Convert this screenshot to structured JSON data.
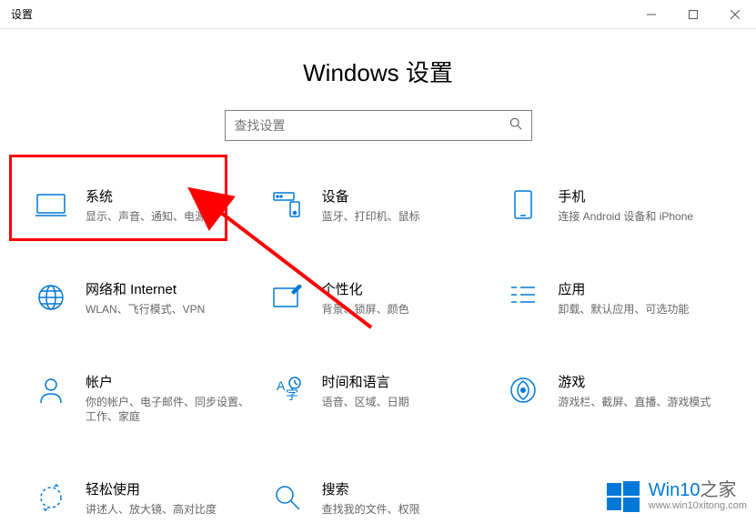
{
  "window": {
    "title": "设置"
  },
  "page": {
    "heading": "Windows 设置"
  },
  "search": {
    "placeholder": "查找设置"
  },
  "tiles": {
    "system": {
      "label": "系统",
      "desc": "显示、声音、通知、电源"
    },
    "devices": {
      "label": "设备",
      "desc": "蓝牙、打印机、鼠标"
    },
    "phone": {
      "label": "手机",
      "desc": "连接 Android 设备和 iPhone"
    },
    "network": {
      "label": "网络和 Internet",
      "desc": "WLAN、飞行模式、VPN"
    },
    "personalization": {
      "label": "个性化",
      "desc": "背景、锁屏、颜色"
    },
    "apps": {
      "label": "应用",
      "desc": "卸载、默认应用、可选功能"
    },
    "accounts": {
      "label": "帐户",
      "desc": "你的帐户、电子邮件、同步设置、工作、家庭"
    },
    "timelang": {
      "label": "时间和语言",
      "desc": "语音、区域、日期"
    },
    "gaming": {
      "label": "游戏",
      "desc": "游戏栏、截屏、直播、游戏模式"
    },
    "ease": {
      "label": "轻松使用",
      "desc": "讲述人、放大镜、高对比度"
    },
    "search_tile": {
      "label": "搜索",
      "desc": "查找我的文件、权限"
    }
  },
  "watermark": {
    "brand": "Win10",
    "suffix": "之家",
    "url": "www.win10xitong.com"
  }
}
